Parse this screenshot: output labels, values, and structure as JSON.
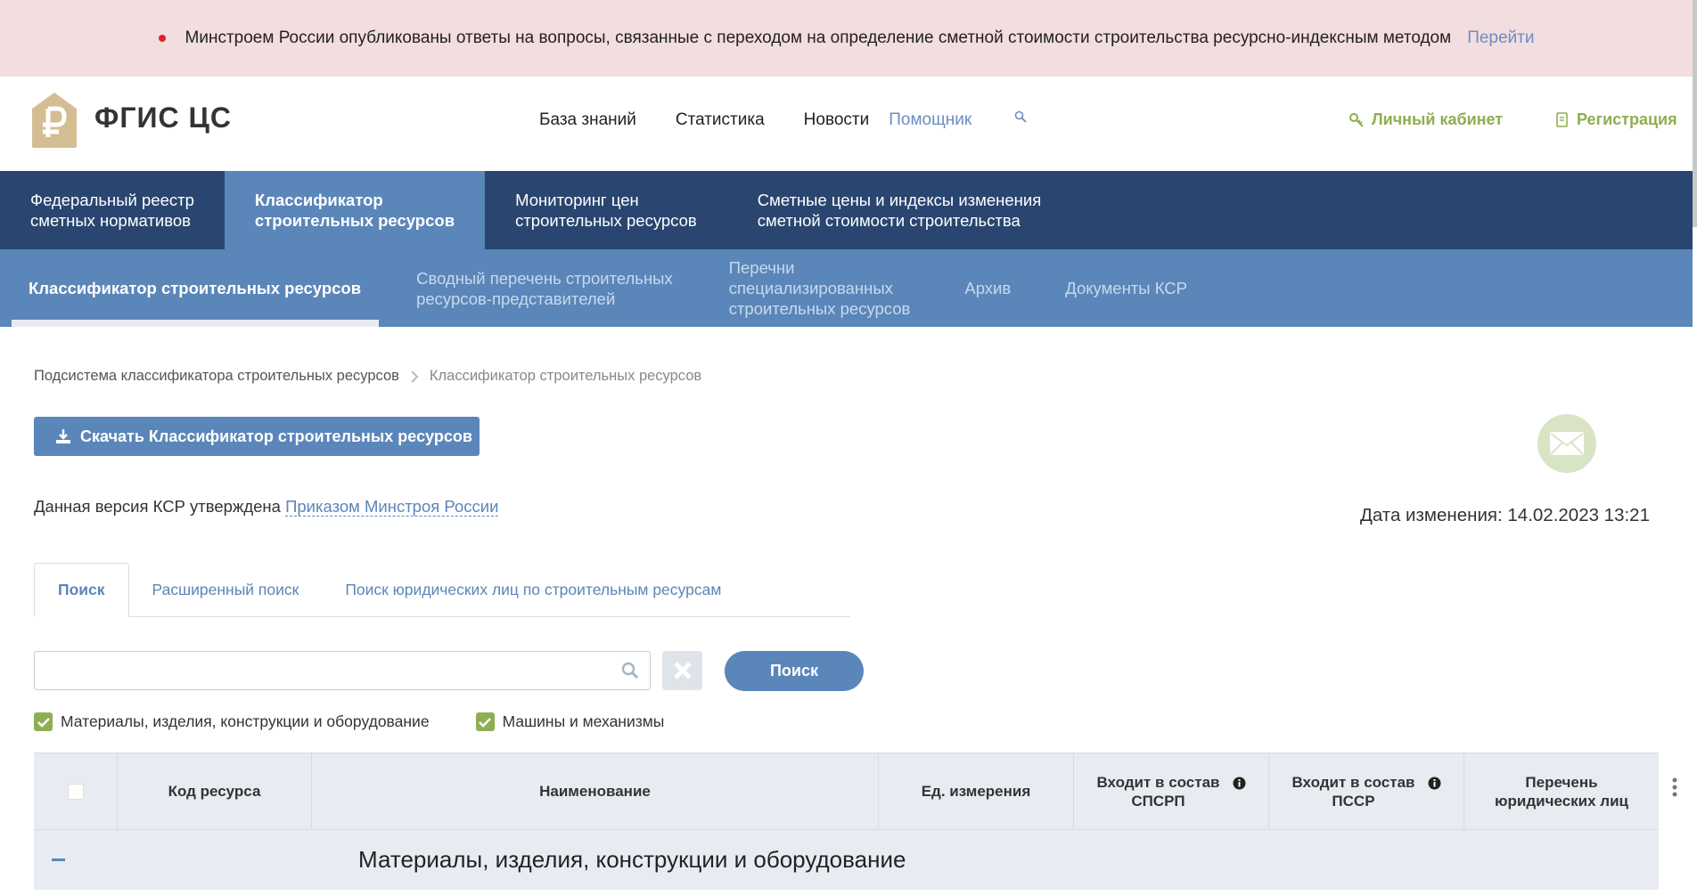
{
  "announcement": {
    "text": "Минстроем России опубликованы ответы на вопросы, связанные с переходом на определение сметной стоимости строительства ресурсно-индексным методом",
    "link": "Перейти"
  },
  "header": {
    "brand": "ФГИС ЦС",
    "nav": [
      "База знаний",
      "Статистика",
      "Новости"
    ],
    "helper": "Помощник",
    "account": "Личный кабинет",
    "register": "Регистрация"
  },
  "main_nav": [
    {
      "line1": "Федеральный реестр",
      "line2": "сметных нормативов"
    },
    {
      "line1": "Классификатор",
      "line2": "строительных ресурсов"
    },
    {
      "line1": "Мониторинг цен",
      "line2": "строительных ресурсов"
    },
    {
      "line1": "Сметные цены и индексы изменения",
      "line2": "сметной стоимости строительства"
    }
  ],
  "sub_nav": [
    {
      "lines": [
        "Классификатор строительных ресурсов"
      ]
    },
    {
      "lines": [
        "Сводный перечень строительных",
        "ресурсов-представителей"
      ]
    },
    {
      "lines": [
        "Перечни",
        "специализированных",
        "строительных ресурсов"
      ]
    },
    {
      "lines": [
        "Архив"
      ]
    },
    {
      "lines": [
        "Документы КСР"
      ]
    }
  ],
  "breadcrumb": {
    "parent": "Подсистема классификатора строительных ресурсов",
    "current": "Классификатор строительных ресурсов"
  },
  "download_button": "Скачать Классификатор строительных ресурсов",
  "approved": {
    "prefix": "Данная версия КСР утверждена",
    "link": "Приказом Минстроя России"
  },
  "change_date": "Дата изменения: 14.02.2023 13:21",
  "tabs": [
    "Поиск",
    "Расширенный поиск",
    "Поиск юридических лиц по строительным ресурсам"
  ],
  "search": {
    "value": "",
    "button": "Поиск"
  },
  "filters": [
    {
      "label": "Материалы, изделия, конструкции и оборудование",
      "checked": true
    },
    {
      "label": "Машины и механизмы",
      "checked": true
    }
  ],
  "table": {
    "columns": {
      "code": "Код ресурса",
      "name": "Наименование",
      "unit": "Ед. измерения",
      "spsrp_1": "Входит в состав",
      "spsrp_2": "СПСРП",
      "pssr_1": "Входит в состав",
      "pssr_2": "ПССР",
      "legal_1": "Перечень",
      "legal_2": "юридических лиц"
    },
    "group_title": "Материалы, изделия, конструкции и оборудование"
  },
  "colors": {
    "announce_bg": "#f2dde0",
    "main_nav": "#2a4670",
    "sub_nav": "#5b86b9",
    "accent_green": "#8eae52",
    "table_header": "#e8ecf2"
  }
}
